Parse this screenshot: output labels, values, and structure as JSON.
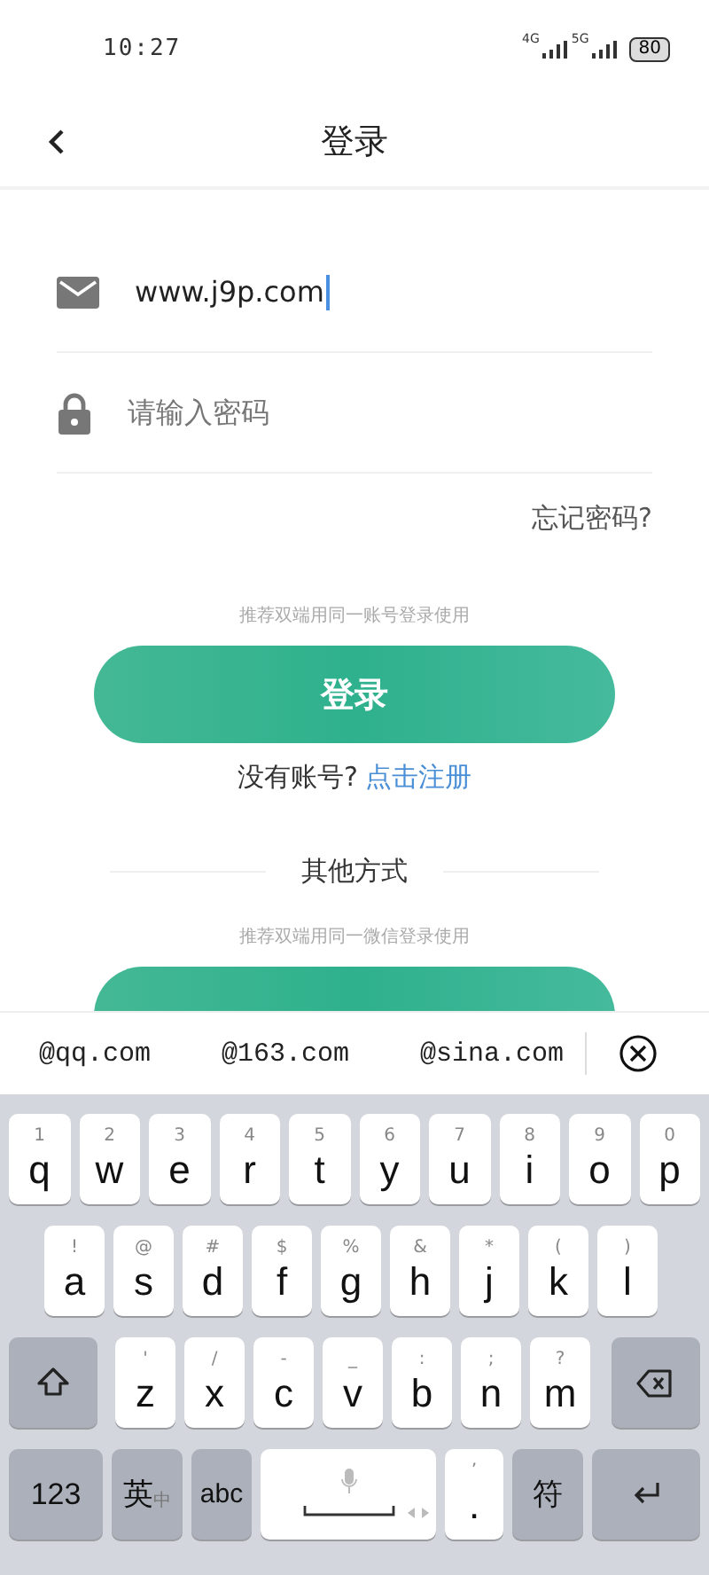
{
  "status_bar": {
    "time": "10:27",
    "network_1": "4G",
    "network_2": "5G",
    "battery": "80"
  },
  "header": {
    "title": "登录"
  },
  "form": {
    "email": {
      "value": "www.j9p.com",
      "focused": true
    },
    "password": {
      "placeholder": "请输入密码"
    },
    "forgot_link": "忘记密码?"
  },
  "login_hint": "推荐双端用同一账号登录使用",
  "login_button": "登录",
  "register": {
    "prompt": "没有账号?",
    "link": "点击注册"
  },
  "other_methods": {
    "title": "其他方式",
    "hint": "推荐双端用同一微信登录使用"
  },
  "suggestions": [
    "@qq.com",
    "@163.com",
    "@sina.com"
  ],
  "keyboard": {
    "rows": [
      [
        {
          "kind": "letter",
          "label": "q",
          "hint": "1"
        },
        {
          "kind": "letter",
          "label": "w",
          "hint": "2"
        },
        {
          "kind": "letter",
          "label": "e",
          "hint": "3"
        },
        {
          "kind": "letter",
          "label": "r",
          "hint": "4"
        },
        {
          "kind": "letter",
          "label": "t",
          "hint": "5"
        },
        {
          "kind": "letter",
          "label": "y",
          "hint": "6"
        },
        {
          "kind": "letter",
          "label": "u",
          "hint": "7"
        },
        {
          "kind": "letter",
          "label": "i",
          "hint": "8"
        },
        {
          "kind": "letter",
          "label": "o",
          "hint": "9"
        },
        {
          "kind": "letter",
          "label": "p",
          "hint": "0"
        }
      ],
      [
        {
          "kind": "letter",
          "label": "a",
          "hint": "!"
        },
        {
          "kind": "letter",
          "label": "s",
          "hint": "@"
        },
        {
          "kind": "letter",
          "label": "d",
          "hint": "#"
        },
        {
          "kind": "letter",
          "label": "f",
          "hint": "$"
        },
        {
          "kind": "letter",
          "label": "g",
          "hint": "%"
        },
        {
          "kind": "letter",
          "label": "h",
          "hint": "&"
        },
        {
          "kind": "letter",
          "label": "j",
          "hint": "*"
        },
        {
          "kind": "letter",
          "label": "k",
          "hint": "("
        },
        {
          "kind": "letter",
          "label": "l",
          "hint": ")"
        }
      ],
      [
        {
          "kind": "shift"
        },
        {
          "kind": "letter",
          "label": "z",
          "hint": "'"
        },
        {
          "kind": "letter",
          "label": "x",
          "hint": "/"
        },
        {
          "kind": "letter",
          "label": "c",
          "hint": "-"
        },
        {
          "kind": "letter",
          "label": "v",
          "hint": "_"
        },
        {
          "kind": "letter",
          "label": "b",
          "hint": ":"
        },
        {
          "kind": "letter",
          "label": "n",
          "hint": ";"
        },
        {
          "kind": "letter",
          "label": "m",
          "hint": "?"
        },
        {
          "kind": "backspace"
        }
      ],
      [
        {
          "kind": "function",
          "label": "123"
        },
        {
          "kind": "lang",
          "label": "英",
          "sub": "中"
        },
        {
          "kind": "function",
          "label": "abc"
        },
        {
          "kind": "space"
        },
        {
          "kind": "punct",
          "label": ".",
          "hint": "’"
        },
        {
          "kind": "function",
          "label": "符"
        },
        {
          "kind": "enter"
        }
      ]
    ]
  }
}
